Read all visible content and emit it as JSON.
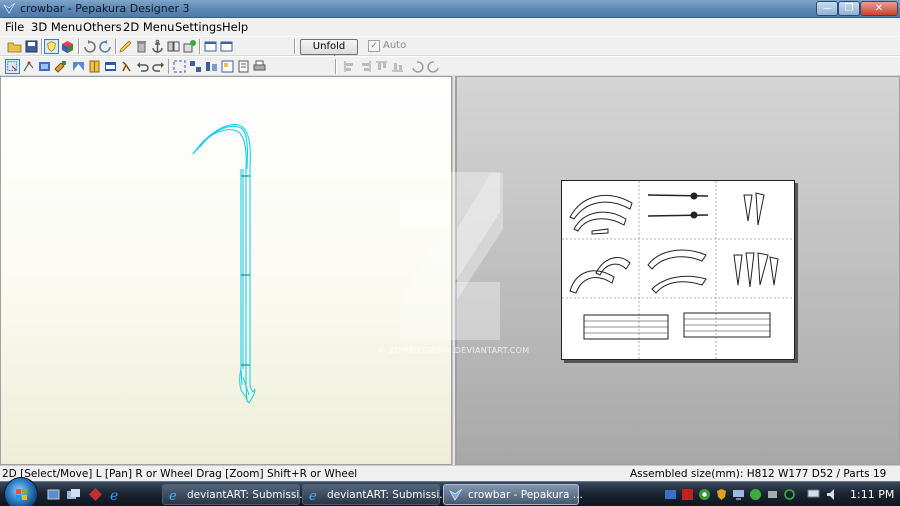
{
  "window": {
    "title": "crowbar - Pepakura Designer 3"
  },
  "menu": [
    "File",
    "3D Menu",
    "Others",
    "2D Menu",
    "Settings",
    "Help"
  ],
  "toolbar": {
    "unfold_undo": "Unfold Undo",
    "auto_label": "Auto",
    "auto_checked": true
  },
  "status": {
    "left": "2D [Select/Move] L [Pan] R or Wheel Drag [Zoom] Shift+R or Wheel",
    "right": "Assembled size(mm): H812 W177 D52 / Parts 19"
  },
  "watermark": "© ZOMBIEGRIMM.DEVIANTART.COM",
  "taskbar": {
    "tasks": [
      "deviantART: Submissi...",
      "deviantART: Submissi...",
      "crowbar - Pepakura ..."
    ],
    "clock": "1:11 PM"
  },
  "colors": {
    "model_wire": "#1ad0e8",
    "pane2d_bg": "#bdbdbd",
    "titlebar": "#5e88b5"
  }
}
